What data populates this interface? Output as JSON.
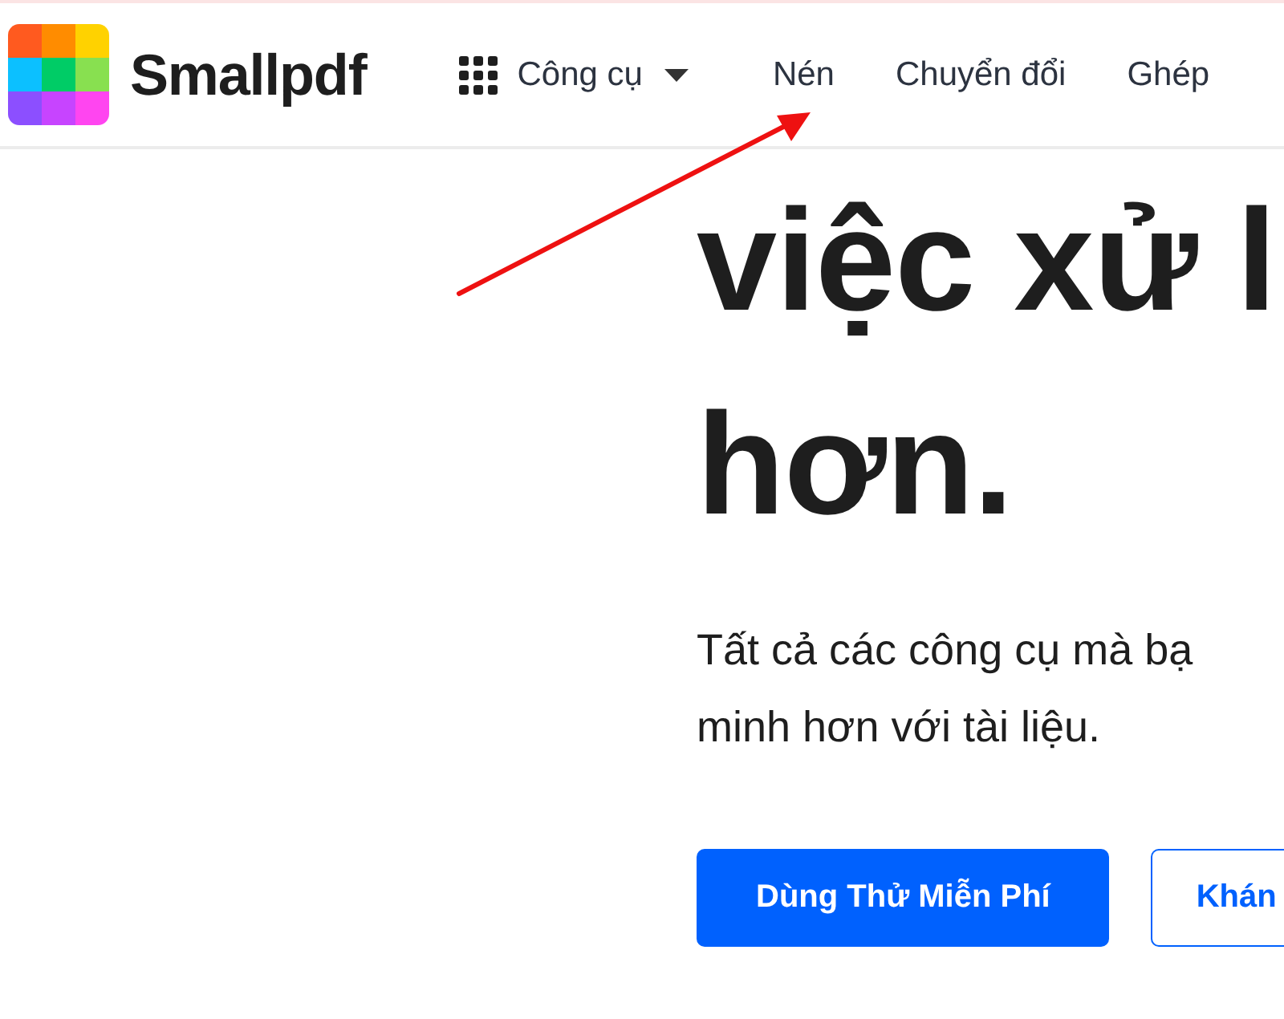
{
  "header": {
    "brand": "Smallpdf",
    "tools_menu": {
      "label": "Công cụ",
      "expanded": false
    },
    "nav_links": [
      "Nén",
      "Chuyển đổi",
      "Ghép"
    ]
  },
  "hero": {
    "headline_lines": [
      "việc xử l",
      "hơn."
    ],
    "subtitle_lines": [
      "Tất cả các công cụ mà bạ",
      "minh hơn với tài liệu."
    ],
    "buttons": [
      {
        "label": "Dùng Thử Miễn Phí",
        "kind": "primary"
      },
      {
        "label": "Khán",
        "kind": "outline"
      }
    ]
  }
}
